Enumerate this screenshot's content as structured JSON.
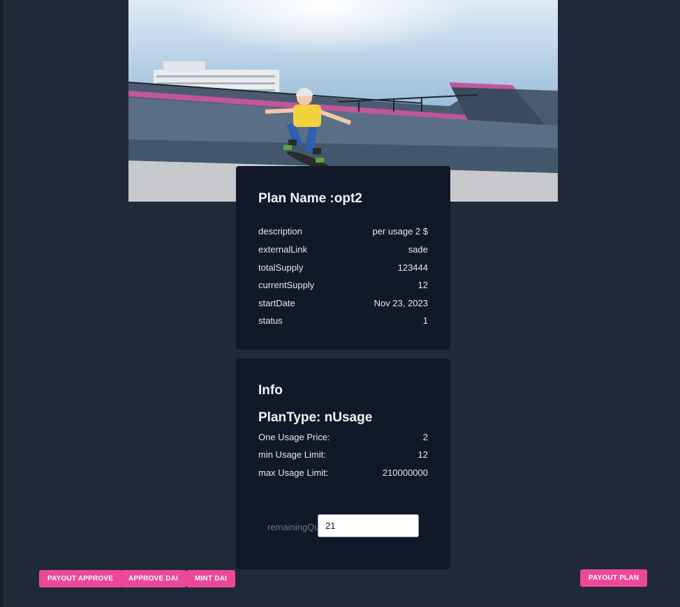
{
  "hero": {
    "alt": "child skateboarding on a ramp"
  },
  "plan_card": {
    "title": "Plan Name :opt2",
    "rows": [
      {
        "label": "description",
        "value": "per usage 2 $"
      },
      {
        "label": "externalLink",
        "value": "sade"
      },
      {
        "label": "totalSupply",
        "value": "123444"
      },
      {
        "label": "currentSupply",
        "value": "12"
      },
      {
        "label": "startDate",
        "value": "Nov 23, 2023"
      },
      {
        "label": "status",
        "value": "1"
      }
    ]
  },
  "info_card": {
    "title": "Info",
    "plan_type": "PlanType: nUsage",
    "rows": [
      {
        "label": "One Usage Price:",
        "value": "2"
      },
      {
        "label": "min Usage Limit:",
        "value": "12"
      },
      {
        "label": "max Usage Limit:",
        "value": "210000000"
      }
    ],
    "remaining": {
      "label": "remainingQuantity",
      "value": "21"
    }
  },
  "buttons": {
    "payout_approve": "PAYOUT APPROVE",
    "approve_dai": "APPROVE DAI",
    "mint_dai": "MINT DAI",
    "payout_plan": "PAYOUT PLAN"
  },
  "colors": {
    "background": "#1f2937",
    "card": "#111827",
    "accent": "#ec4899"
  }
}
